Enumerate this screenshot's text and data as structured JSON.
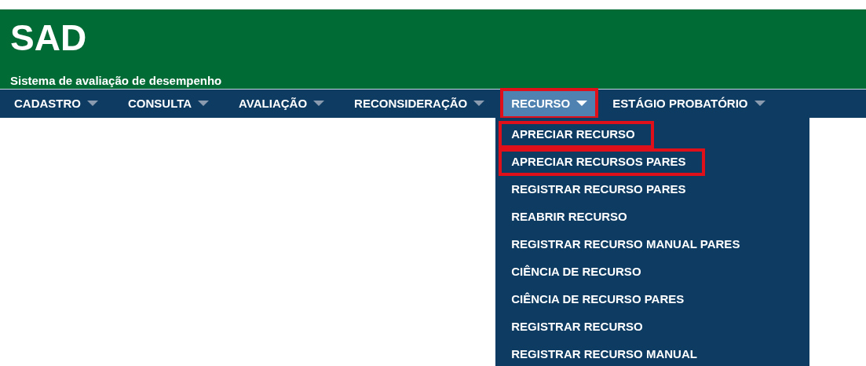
{
  "header": {
    "title": "SAD",
    "subtitle": "Sistema de avaliação de desempenho"
  },
  "menu": [
    {
      "label": "CADASTRO",
      "selected": false,
      "highlighted": false
    },
    {
      "label": "CONSULTA",
      "selected": false,
      "highlighted": false
    },
    {
      "label": "AVALIAÇÃO",
      "selected": false,
      "highlighted": false
    },
    {
      "label": "RECONSIDERAÇÃO",
      "selected": false,
      "highlighted": false
    },
    {
      "label": "RECURSO",
      "selected": true,
      "highlighted": true,
      "items": [
        {
          "label": "APRECIAR RECURSO",
          "highlighted": true
        },
        {
          "label": "APRECIAR RECURSOS PARES",
          "highlighted": true
        },
        {
          "label": "REGISTRAR RECURSO PARES",
          "highlighted": false
        },
        {
          "label": "REABRIR RECURSO",
          "highlighted": false
        },
        {
          "label": "REGISTRAR RECURSO MANUAL PARES",
          "highlighted": false
        },
        {
          "label": "CIÊNCIA DE RECURSO",
          "highlighted": false
        },
        {
          "label": "CIÊNCIA DE RECURSO PARES",
          "highlighted": false
        },
        {
          "label": "REGISTRAR RECURSO",
          "highlighted": false
        },
        {
          "label": "REGISTRAR RECURSO MANUAL",
          "highlighted": false
        }
      ]
    },
    {
      "label": "ESTÁGIO PROBATÓRIO",
      "selected": false,
      "highlighted": false
    }
  ]
}
